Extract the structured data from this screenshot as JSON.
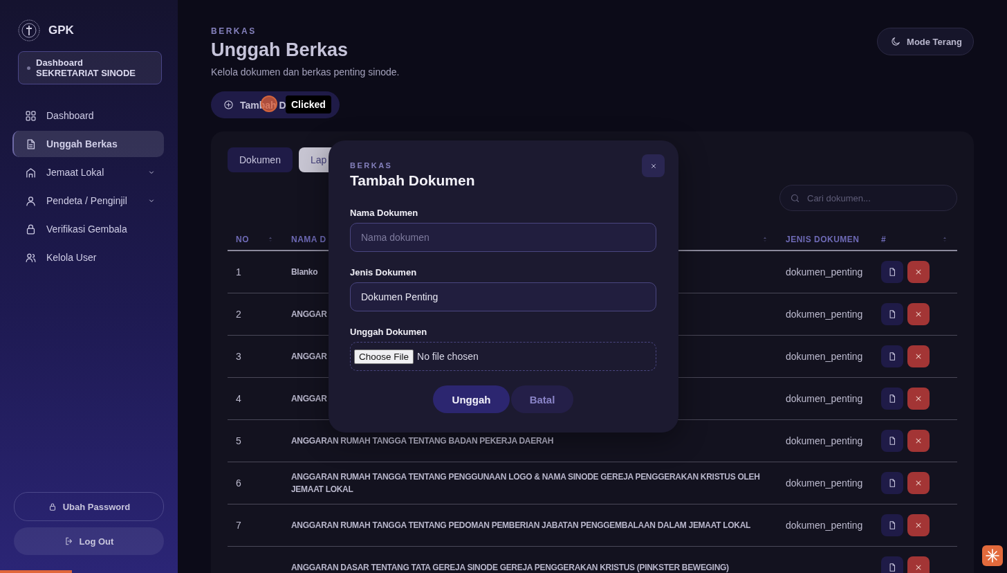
{
  "sidebar": {
    "brand": "GPK",
    "role": {
      "line_1": "Dashboard",
      "line_2": "SEKRETARIAT SINODE"
    },
    "items": [
      {
        "label": "Dashboard",
        "selected": false
      },
      {
        "label": "Unggah Berkas",
        "selected": true
      },
      {
        "label": "Jemaat Lokal",
        "selected": false,
        "expanded": false
      },
      {
        "label": "Pendeta / Penginjil",
        "selected": false,
        "expanded": false
      },
      {
        "label": "Verifikasi Gembala",
        "selected": false
      },
      {
        "label": "Kelola User",
        "selected": false
      }
    ],
    "bottom_buttons": [
      {
        "label": "Ubah Password",
        "kind": "outline"
      },
      {
        "label": "Log Out",
        "kind": "filled"
      }
    ]
  },
  "header": {
    "eyebrow": "BERKAS",
    "title": "Unggah Berkas",
    "subtitle": "Kelola dokumen dan berkas penting sinode.",
    "theme_button": "Mode Terang"
  },
  "add_button": {
    "label": "Tambah D"
  },
  "tooltip": "Clicked",
  "tabs": [
    {
      "label": "Dokumen",
      "selected": true
    },
    {
      "label": "Lap",
      "selected": false
    }
  ],
  "search": {
    "placeholder": "Cari dokumen..."
  },
  "table": {
    "columns": [
      "NO",
      "NAMA D",
      "JENIS DOKUMEN",
      "#"
    ],
    "rows": [
      {
        "no": "1",
        "name": "Blanko",
        "type": "dokumen_penting"
      },
      {
        "no": "2",
        "name": "ANGGAR",
        "type": "dokumen_penting"
      },
      {
        "no": "3",
        "name": "ANGGAR",
        "type": "dokumen_penting"
      },
      {
        "no": "4",
        "name": "ANGGAR",
        "type": "dokumen_penting"
      },
      {
        "no": "5",
        "name": "ANGGARAN RUMAH TANGGA TENTANG BADAN PEKERJA DAERAH",
        "type": "dokumen_penting"
      },
      {
        "no": "6",
        "name": "ANGGARAN RUMAH TANGGA TENTANG PENGGUNAAN LOGO & NAMA SINODE GEREJA PENGGERAKAN KRISTUS OLEH JEMAAT LOKAL",
        "type": "dokumen_penting"
      },
      {
        "no": "7",
        "name": "ANGGARAN RUMAH TANGGA TENTANG PEDOMAN PEMBERIAN JABATAN PENGGEMBALAAN DALAM JEMAAT LOKAL",
        "type": "dokumen_penting"
      },
      {
        "name": "ANGGARAN DASAR TENTANG TATA GEREJA SINODE GEREJA PENGGERAKAN KRISTUS (PINKSTER BEWEGING)"
      }
    ]
  },
  "modal": {
    "eyebrow": "BERKAS",
    "title": "Tambah Dokumen",
    "fields": [
      {
        "kind": "text",
        "label": "Nama Dokumen",
        "placeholder": "Nama dokumen"
      },
      {
        "kind": "select",
        "label": "Jenis Dokumen",
        "value": "Dokumen Penting"
      },
      {
        "kind": "file",
        "label": "Unggah Dokumen",
        "button": "Choose File",
        "value": "No file chosen"
      }
    ],
    "buttons": [
      {
        "label": "Unggah",
        "kind": "primary"
      },
      {
        "label": "Batal",
        "kind": "secondary"
      }
    ]
  }
}
